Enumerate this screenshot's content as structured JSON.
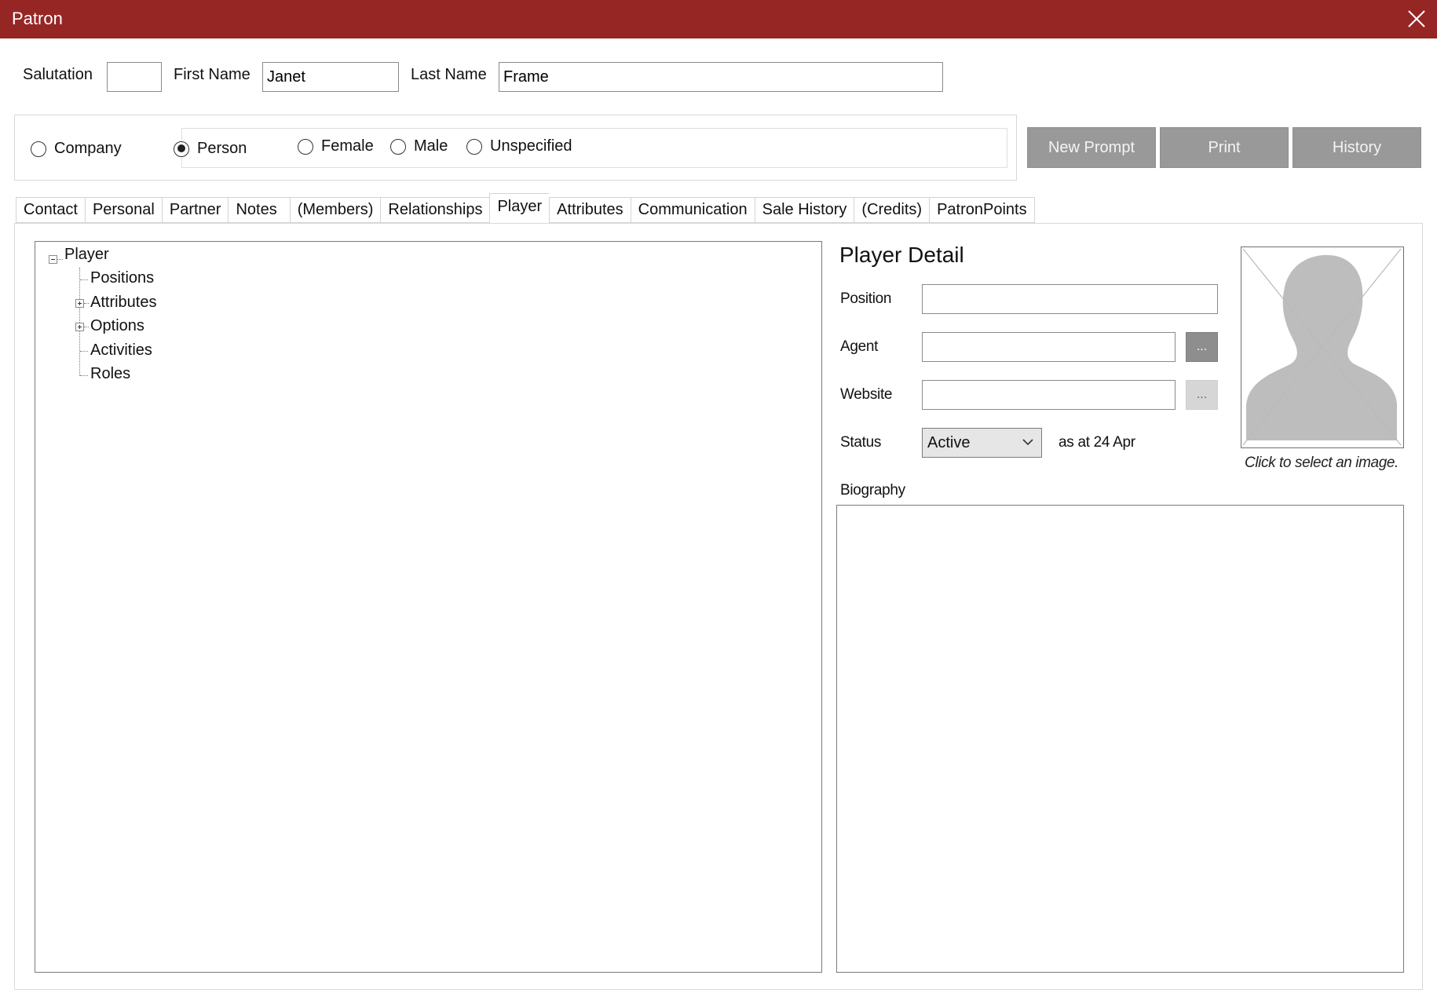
{
  "window": {
    "title": "Patron"
  },
  "name_row": {
    "salutation_label": "Salutation",
    "salutation_value": "",
    "first_name_label": "First Name",
    "first_name_value": "Janet",
    "last_name_label": "Last Name",
    "last_name_value": "Frame"
  },
  "type_group": {
    "company_label": "Company",
    "person_label": "Person",
    "selected": "Person",
    "gender": {
      "female_label": "Female",
      "male_label": "Male",
      "unspecified_label": "Unspecified"
    }
  },
  "actions": {
    "new_prompt_label": "New Prompt",
    "print_label": "Print",
    "history_label": "History"
  },
  "tabs": [
    {
      "label": "Contact"
    },
    {
      "label": "Personal"
    },
    {
      "label": "Partner"
    },
    {
      "label": "Notes"
    },
    {
      "label": "(Members)"
    },
    {
      "label": "Relationships"
    },
    {
      "label": "Player"
    },
    {
      "label": "Attributes"
    },
    {
      "label": "Communication"
    },
    {
      "label": "Sale History"
    },
    {
      "label": "(Credits)"
    },
    {
      "label": "PatronPoints"
    }
  ],
  "active_tab": "Player",
  "tree": {
    "root_label": "Player",
    "children": [
      {
        "label": "Positions",
        "expandable": false
      },
      {
        "label": "Attributes",
        "expandable": true
      },
      {
        "label": "Options",
        "expandable": true
      },
      {
        "label": "Activities",
        "expandable": false
      },
      {
        "label": "Roles",
        "expandable": false
      }
    ]
  },
  "player_detail": {
    "title": "Player Detail",
    "position_label": "Position",
    "position_value": "",
    "agent_label": "Agent",
    "agent_value": "",
    "website_label": "Website",
    "website_value": "",
    "ellipsis_label": "...",
    "status_label": "Status",
    "status_value": "Active",
    "status_date_text": "as at 24 Apr",
    "photo_caption": "Click to select an image.",
    "biography_label": "Biography",
    "biography_value": ""
  },
  "icons": {
    "close": "close-icon",
    "photo_placeholder": "person-silhouette-icon",
    "combo_arrow": "chevron-down-icon",
    "tree_collapse": "minus-box-icon",
    "tree_expand": "plus-box-icon"
  },
  "colors": {
    "titlebar": "#962624",
    "button_gray": "#999999"
  }
}
